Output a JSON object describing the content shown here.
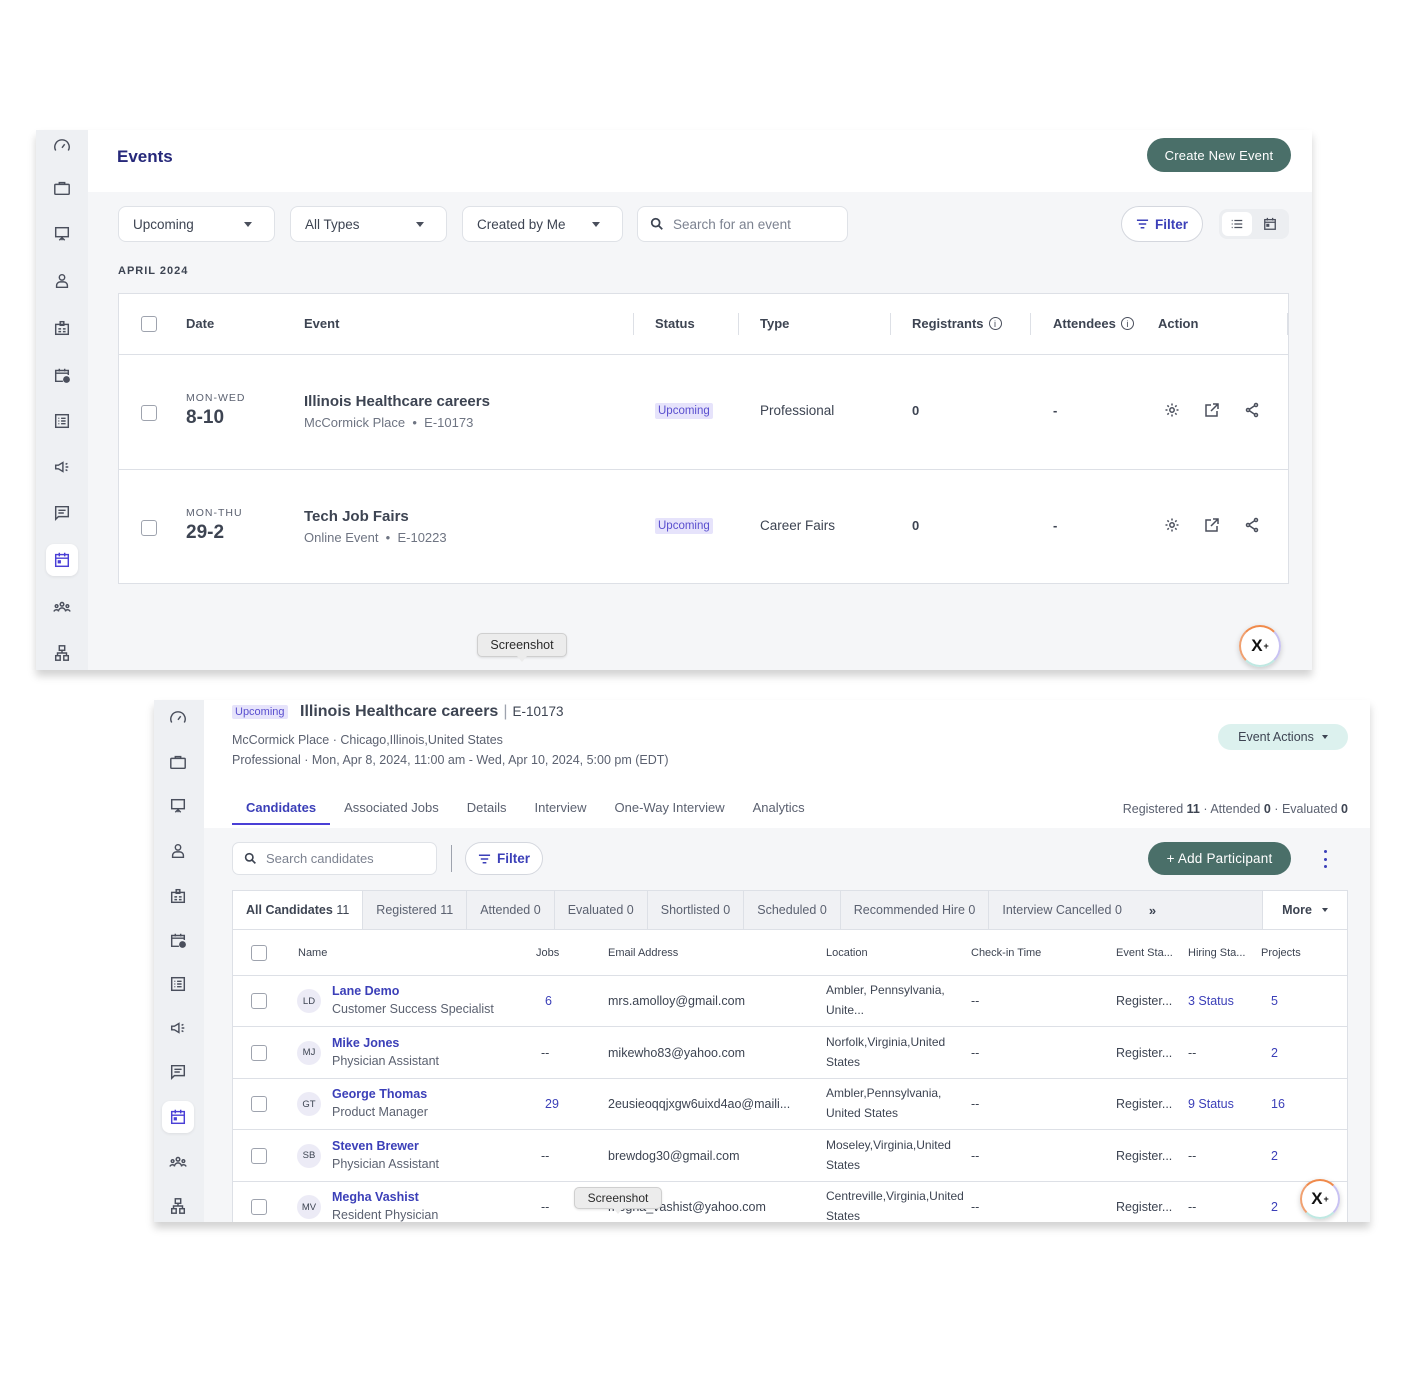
{
  "sidebar": {
    "items": [
      {
        "name": "dashboard",
        "icon": "speedometer-icon"
      },
      {
        "name": "jobs",
        "icon": "briefcase-icon"
      },
      {
        "name": "presentations",
        "icon": "presentation-board-icon"
      },
      {
        "name": "candidates",
        "icon": "user-icon"
      },
      {
        "name": "id-cards",
        "icon": "id-badge-icon"
      },
      {
        "name": "schedule",
        "icon": "calendar-clock-icon"
      },
      {
        "name": "lists",
        "icon": "list-icon"
      },
      {
        "name": "campaigns",
        "icon": "megaphone-icon"
      },
      {
        "name": "messages",
        "icon": "message-icon"
      },
      {
        "name": "events",
        "icon": "calendar-icon",
        "active": true
      },
      {
        "name": "teams",
        "icon": "group-icon"
      },
      {
        "name": "org-chart",
        "icon": "hierarchy-icon"
      }
    ]
  },
  "events_page": {
    "title": "Events",
    "create_button": "Create New Event",
    "filters": {
      "timeframe": "Upcoming",
      "type": "All Types",
      "owner": "Created by Me",
      "search_placeholder": "Search for an event",
      "filter_label": "Filter"
    },
    "month_label": "APRIL 2024",
    "columns": [
      "Date",
      "Event",
      "Status",
      "Type",
      "Registrants",
      "Attendees",
      "Action"
    ],
    "rows": [
      {
        "days": "MON-WED",
        "range": "8-10",
        "name": "Illinois Healthcare careers",
        "location": "McCormick Place",
        "id": "E-10173",
        "status": "Upcoming",
        "type": "Professional",
        "registrants": "0",
        "attendees": "-"
      },
      {
        "days": "MON-THU",
        "range": "29-2",
        "name": "Tech Job Fairs",
        "location": "Online Event",
        "id": "E-10223",
        "status": "Upcoming",
        "type": "Career Fairs",
        "registrants": "0",
        "attendees": "-"
      }
    ],
    "separator": "•"
  },
  "tooltip": {
    "label": "Screenshot"
  },
  "fab": {
    "label": "X",
    "sup": "+"
  },
  "event_detail": {
    "status": "Upcoming",
    "title": "Illinois Healthcare careers",
    "separator": "|",
    "id": "E-10173",
    "location_line": "McCormick Place · Chicago,Illinois,United States",
    "schedule_line": "Professional · Mon, Apr 8, 2024, 11:00 am - Wed, Apr 10, 2024, 5:00 pm (EDT)",
    "actions_button": "Event Actions",
    "tabs": [
      "Candidates",
      "Associated Jobs",
      "Details",
      "Interview",
      "One-Way Interview",
      "Analytics"
    ],
    "active_tab": "Candidates",
    "counts": {
      "registered_label": "Registered",
      "registered": "11",
      "attended_label": "Attended",
      "attended": "0",
      "evaluated_label": "Evaluated",
      "evaluated": "0",
      "dot": "·"
    },
    "search_placeholder": "Search candidates",
    "filter_label": "Filter",
    "add_button": "+ Add Participant",
    "status_tabs": [
      {
        "label": "All Candidates",
        "count": "11",
        "active": true
      },
      {
        "label": "Registered",
        "count": "11"
      },
      {
        "label": "Attended",
        "count": "0"
      },
      {
        "label": "Evaluated",
        "count": "0"
      },
      {
        "label": "Shortlisted",
        "count": "0"
      },
      {
        "label": "Scheduled",
        "count": "0"
      },
      {
        "label": "Recommended Hire",
        "count": "0"
      },
      {
        "label": "Interview Cancelled",
        "count": "0"
      }
    ],
    "scroll_label": "»",
    "more_label": "More",
    "columns": [
      "Name",
      "Jobs",
      "Email Address",
      "Location",
      "Check-in Time",
      "Event Sta...",
      "Hiring Sta...",
      "Projects"
    ],
    "candidates": [
      {
        "initials": "LD",
        "name": "Lane Demo",
        "role": "Customer Success Specialist",
        "jobs": "6",
        "email": "mrs.amolloy@gmail.com",
        "location": "Ambler, Pennsylvania, Unite...",
        "checkin": "--",
        "event_status": "Register...",
        "hiring_status": "3 Status",
        "projects": "5"
      },
      {
        "initials": "MJ",
        "name": "Mike Jones",
        "role": "Physician Assistant",
        "jobs": "--",
        "email": "mikewho83@yahoo.com",
        "location": "Norfolk,Virginia,United States",
        "checkin": "--",
        "event_status": "Register...",
        "hiring_status": "--",
        "projects": "2"
      },
      {
        "initials": "GT",
        "name": "George Thomas",
        "role": "Product Manager",
        "jobs": "29",
        "email": "2eusieoqqjxgw6uixd4ao@maili...",
        "location": "Ambler,Pennsylvania, United States",
        "checkin": "--",
        "event_status": "Register...",
        "hiring_status": "9 Status",
        "projects": "16"
      },
      {
        "initials": "SB",
        "name": "Steven Brewer",
        "role": "Physician Assistant",
        "jobs": "--",
        "email": "brewdog30@gmail.com",
        "location": "Moseley,Virginia,United States",
        "checkin": "--",
        "event_status": "Register...",
        "hiring_status": "--",
        "projects": "2"
      },
      {
        "initials": "MV",
        "name": "Megha Vashist",
        "role": "Resident Physician",
        "jobs": "--",
        "email": "megha_vashist@yahoo.com",
        "location": "Centreville,Virginia,United States",
        "checkin": "--",
        "event_status": "Register...",
        "hiring_status": "--",
        "projects": "2"
      }
    ]
  },
  "colors": {
    "primary_button": "#4a6f69",
    "accent": "#3b3fb8",
    "badge_bg": "#e6e3fb",
    "event_actions_bg": "#dcf1ee"
  }
}
